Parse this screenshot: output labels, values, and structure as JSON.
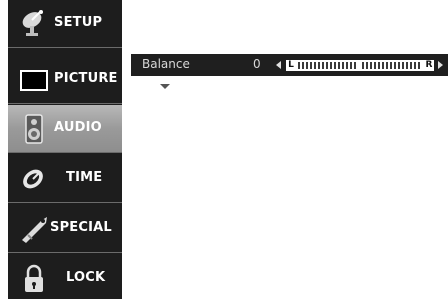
{
  "menu": {
    "items": [
      {
        "label": "SETUP",
        "icon": "satellite-dish-icon",
        "selected": false
      },
      {
        "label": "PICTURE",
        "icon": "monitor-icon",
        "selected": false
      },
      {
        "label": "AUDIO",
        "icon": "speaker-icon",
        "selected": true
      },
      {
        "label": "TIME",
        "icon": "clock-icon",
        "selected": false
      },
      {
        "label": "SPECIAL",
        "icon": "tag-icon",
        "selected": false
      },
      {
        "label": "LOCK",
        "icon": "padlock-icon",
        "selected": false
      }
    ]
  },
  "balance": {
    "label": "Balance",
    "value": "0",
    "left_marker": "L",
    "right_marker": "R",
    "position": 0.5
  },
  "colors": {
    "sidebar_bg": "#1d1d1d",
    "selected_bg": "#9a9a9a",
    "bar_bg": "#1f1f1f"
  }
}
